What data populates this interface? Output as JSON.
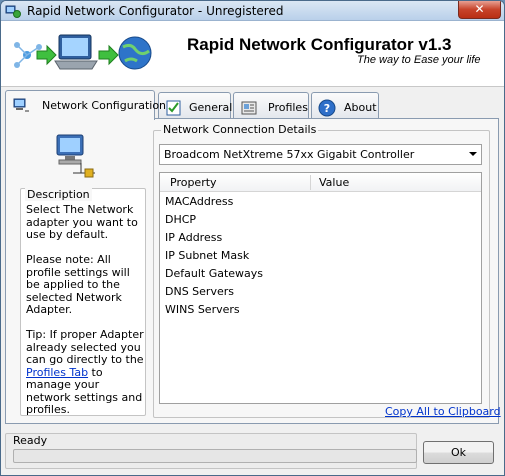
{
  "window": {
    "title": "Rapid Network Configurator - Unregistered",
    "close_label": "✕"
  },
  "banner": {
    "title": "Rapid Network Configurator v1.3",
    "subtitle": "The way to Ease your life"
  },
  "tabs": [
    {
      "label": "Network Configuration",
      "icon": "network-adapter-icon",
      "active": true
    },
    {
      "label": "General",
      "icon": "checklist-icon",
      "active": false
    },
    {
      "label": "Profiles",
      "icon": "profiles-icon",
      "active": false
    },
    {
      "label": "About",
      "icon": "help-icon",
      "active": false
    }
  ],
  "description": {
    "legend": "Description",
    "p1": "Select The Network adapter you want to use by default.",
    "p2": "Please note: All profile settings will be applied to the selected Network Adapter.",
    "p3_before": "Tip: If proper Adapter already selected you can go directly to the ",
    "p3_link": "Profiles Tab",
    "p3_after": " to manage your network settings and profiles."
  },
  "connection": {
    "legend": "Network Connection Details",
    "adapter_selected": "Broadcom NetXtreme 57xx Gigabit Controller",
    "columns": [
      "Property",
      "Value"
    ],
    "rows": [
      {
        "property": "MACAddress",
        "value": ""
      },
      {
        "property": "DHCP",
        "value": ""
      },
      {
        "property": "IP Address",
        "value": ""
      },
      {
        "property": "IP Subnet Mask",
        "value": ""
      },
      {
        "property": "Default Gateways",
        "value": ""
      },
      {
        "property": "DNS Servers",
        "value": ""
      },
      {
        "property": "WINS Servers",
        "value": ""
      }
    ],
    "copy_link": "Copy All to Clipboard"
  },
  "status": {
    "text": "Ready",
    "progress": 0
  },
  "buttons": {
    "ok": "Ok"
  },
  "colors": {
    "link": "#0033cc",
    "close": "#c7432a"
  }
}
